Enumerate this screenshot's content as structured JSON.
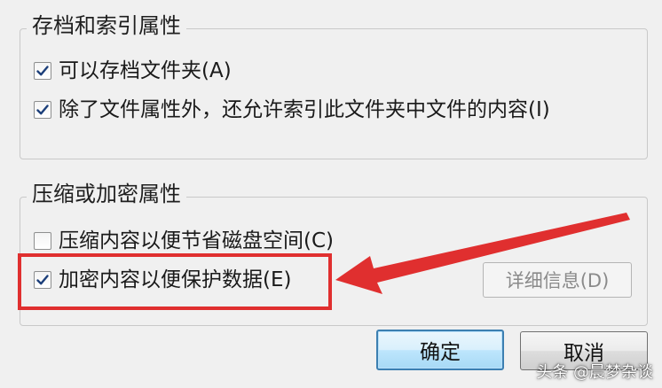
{
  "archive_group": {
    "title": "存档和索引属性",
    "options": [
      {
        "label": "可以存档文件夹(A)",
        "checked": true
      },
      {
        "label": "除了文件属性外，还允许索引此文件夹中文件的内容(I)",
        "checked": true
      }
    ]
  },
  "compress_group": {
    "title": "压缩或加密属性",
    "options": [
      {
        "label": "压缩内容以便节省磁盘空间(C)",
        "checked": false
      },
      {
        "label": "加密内容以便保护数据(E)",
        "checked": true
      }
    ],
    "details_label": "详细信息(D)"
  },
  "buttons": {
    "ok_label": "确定",
    "cancel_label": "取消"
  },
  "annotation": {
    "color": "#e02f2f"
  },
  "watermark": "头条 @晨梦杂谈"
}
